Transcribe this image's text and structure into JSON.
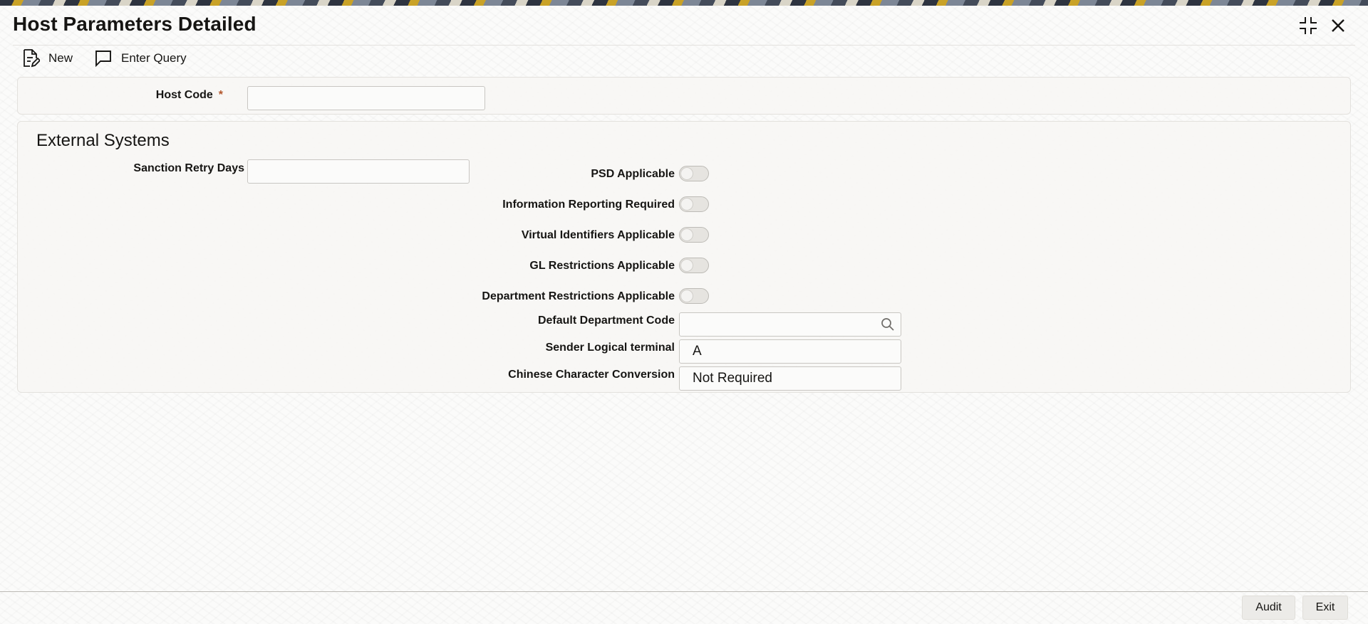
{
  "window": {
    "title": "Host Parameters Detailed"
  },
  "toolbar": {
    "new_label": "New",
    "enter_query_label": "Enter Query"
  },
  "host_section": {
    "host_code_label": "Host Code",
    "host_code_required_marker": "*",
    "host_code_value": ""
  },
  "external_systems": {
    "title": "External Systems",
    "sanction_retry_days_label": "Sanction Retry Days",
    "sanction_retry_days_value": "",
    "toggles": [
      {
        "label": "PSD Applicable",
        "checked": false
      },
      {
        "label": "Information Reporting Required",
        "checked": false
      },
      {
        "label": "Virtual Identifiers Applicable",
        "checked": false
      },
      {
        "label": "GL Restrictions Applicable",
        "checked": false
      },
      {
        "label": "Department Restrictions Applicable",
        "checked": false
      }
    ],
    "default_department_code_label": "Default Department Code",
    "default_department_code_value": "",
    "sender_logical_terminal_label": "Sender Logical terminal",
    "sender_logical_terminal_value": "A",
    "chinese_character_conversion_label": "Chinese Character Conversion",
    "chinese_character_conversion_value": "Not Required"
  },
  "footer": {
    "audit_label": "Audit",
    "exit_label": "Exit"
  },
  "icons": {
    "new": "new-document-icon",
    "enter_query": "chat-bubble-icon",
    "minimize": "collapse-icon",
    "close": "close-icon",
    "lookup": "search-icon"
  }
}
